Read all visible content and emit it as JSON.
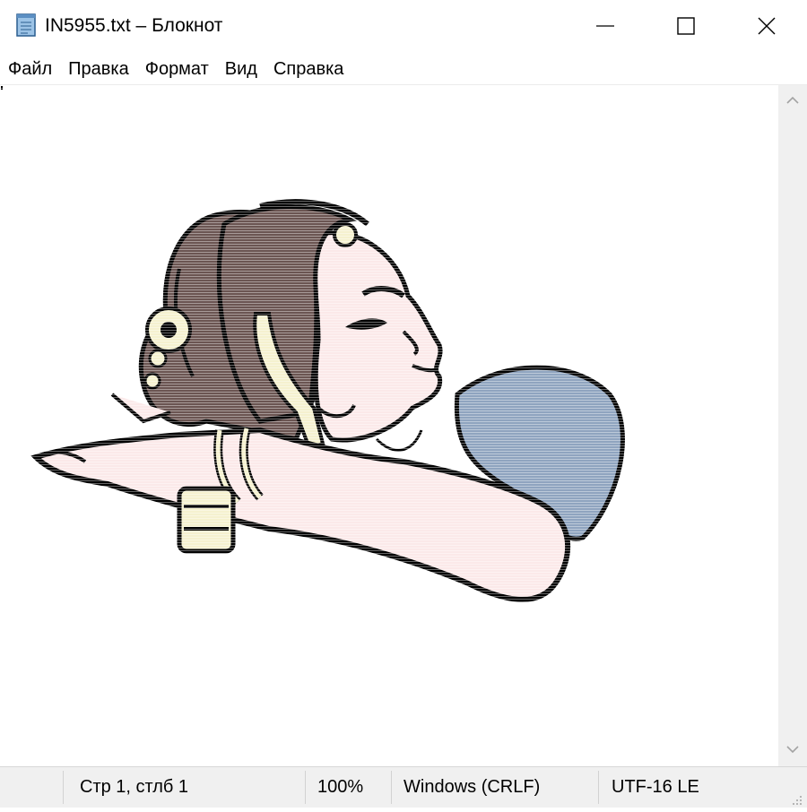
{
  "window": {
    "title": "IN5955.txt – Блокнот",
    "icon": "notepad-icon",
    "controls": [
      "minimize-icon",
      "maximize-icon",
      "close-icon"
    ]
  },
  "menu": {
    "items": [
      "Файл",
      "Правка",
      "Формат",
      "Вид",
      "Справка"
    ]
  },
  "statusbar": {
    "position": "Стр 1, стлб 1",
    "zoom": "100%",
    "line_endings": "Windows (CRLF)",
    "encoding": "UTF-16 LE"
  },
  "colors": {
    "hair": "#6b5552",
    "skin": "#fbe9e9",
    "garment": "#8fa4bf",
    "ornament": "#f5f1cf",
    "outline": "#000000"
  }
}
